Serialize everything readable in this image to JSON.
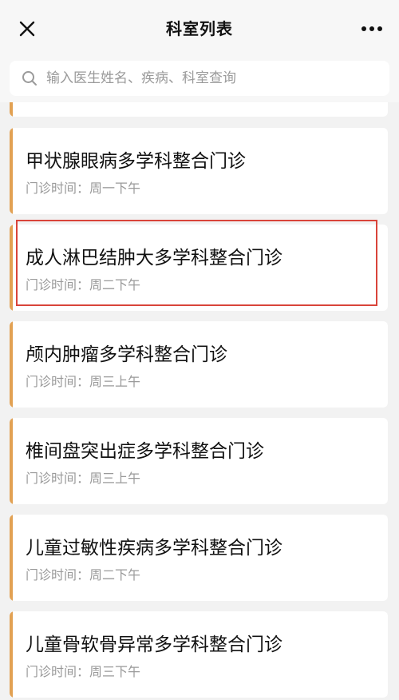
{
  "header": {
    "title": "科室列表"
  },
  "search": {
    "placeholder": "输入医生姓名、疾病、科室查询"
  },
  "departments": [
    {
      "name": "甲状腺眼病多学科整合门诊",
      "time": "门诊时间：周一下午"
    },
    {
      "name": "成人淋巴结肿大多学科整合门诊",
      "time": "门诊时间：周二下午"
    },
    {
      "name": "颅内肿瘤多学科整合门诊",
      "time": "门诊时间：周三上午"
    },
    {
      "name": "椎间盘突出症多学科整合门诊",
      "time": "门诊时间：周三上午"
    },
    {
      "name": "儿童过敏性疾病多学科整合门诊",
      "time": "门诊时间：周二下午"
    },
    {
      "name": "儿童骨软骨异常多学科整合门诊",
      "time": "门诊时间：周三下午"
    }
  ],
  "highlight": {
    "color": "#d9443a",
    "index": 2
  },
  "colors": {
    "accent": "#e2a153",
    "background": "#f2f2f2"
  }
}
